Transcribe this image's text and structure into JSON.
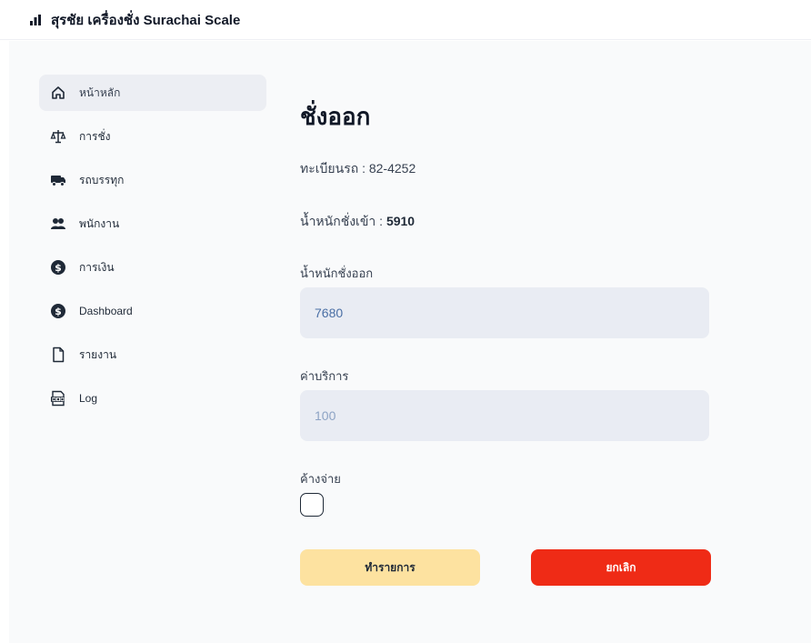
{
  "app": {
    "title": "สุรชัย เครื่องชั่ง  Surachai Scale"
  },
  "sidebar": {
    "items": [
      {
        "label": "หน้าหลัก",
        "icon": "home-icon",
        "active": true
      },
      {
        "label": "การชั่ง",
        "icon": "scale-icon",
        "active": false
      },
      {
        "label": "รถบรรทุก",
        "icon": "truck-icon",
        "active": false
      },
      {
        "label": "พนักงาน",
        "icon": "users-icon",
        "active": false
      },
      {
        "label": "การเงิน",
        "icon": "dollar-icon",
        "active": false
      },
      {
        "label": "Dashboard",
        "icon": "dollar-icon",
        "active": false
      },
      {
        "label": "รายงาน",
        "icon": "file-icon",
        "active": false
      },
      {
        "label": "Log",
        "icon": "log-file-icon",
        "active": false
      }
    ]
  },
  "form": {
    "title": "ชั่งออก",
    "plate_label": "ทะเบียนรถ : 82-4252",
    "weight_in_label": "น้ำหนักชั่งเข้า : ",
    "weight_in_value": "5910",
    "weight_out_label": "น้ำหนักชั่งออก",
    "weight_out_value": "7680",
    "service_label": "ค่าบริการ",
    "service_value": "100",
    "unpaid_label": "ค้างจ่าย",
    "unpaid_checked": false,
    "confirm_label": "ทำรายการ",
    "cancel_label": "ยกเลิก"
  },
  "colors": {
    "confirm": "#fde2a0",
    "cancel": "#ef2b16",
    "input_bg": "#e9ecf3",
    "active_nav": "#eceef3"
  }
}
